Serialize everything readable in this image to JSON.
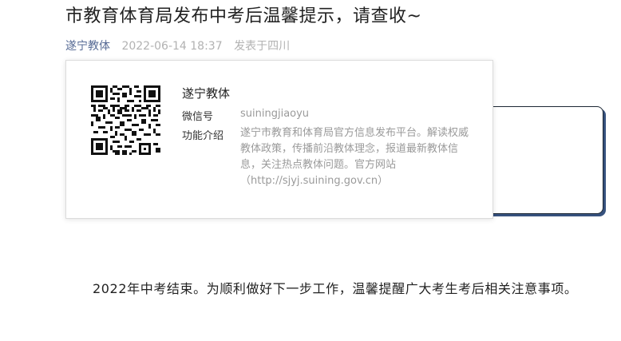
{
  "article": {
    "title": "市教育体育局发布中考后温馨提示，请查收~",
    "author": "遂宁教体",
    "date": "2022-06-14 18:37",
    "location": "发表于四川",
    "body": "2022年中考结束。为顺利做好下一步工作，温馨提醒广大考生考后相关注意事项。"
  },
  "profile": {
    "name": "遂宁教体",
    "wechat_label": "微信号",
    "wechat_id": "suiningjiaoyu",
    "intro_label": "功能介绍",
    "intro": "遂宁市教育和体育局官方信息发布平台。解读权威教体政策，传播前沿教体理念，报道最新教体信息，关注热点教体问题。官方网站（http://sjyj.suining.gov.cn）",
    "qr_icon": "qr-code-icon"
  },
  "colors": {
    "link": "#576b95",
    "muted": "#b2b2b2",
    "card_border": "#1c2733",
    "card_shadow": "#37527e"
  }
}
